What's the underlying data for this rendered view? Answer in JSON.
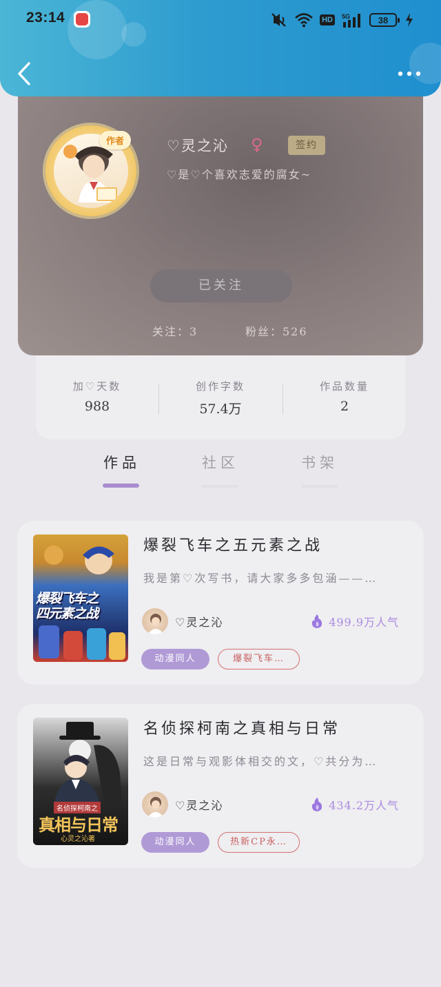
{
  "status_bar": {
    "time": "23:14",
    "signal": "5G",
    "hd": "HD",
    "battery": "38"
  },
  "header": {
    "back_icon": "chevron-left-icon",
    "more_icon": "more-horizontal-icon"
  },
  "profile": {
    "author_tag": "作者",
    "name": "♡灵之沁",
    "gender_symbol": "♀",
    "sign_badge": "签约",
    "bio": "♡是♡个喜欢志爱的腐女~",
    "follow_button": "已关注",
    "following": "关注：3",
    "fans": "粉丝：526"
  },
  "stats": [
    {
      "label": "加♡天数",
      "value": "988"
    },
    {
      "label": "创作字数",
      "value": "57.4万"
    },
    {
      "label": "作品数量",
      "value": "2"
    }
  ],
  "tabs": [
    {
      "label": "作品",
      "active": true
    },
    {
      "label": "社区",
      "active": false
    },
    {
      "label": "书架",
      "active": false
    }
  ],
  "books": [
    {
      "title": "爆裂飞车之五元素之战",
      "description": "我是第♡次写书，请大家多多包涵——…",
      "cover_text_1": "爆裂飞车之",
      "cover_text_2": "四元素之战",
      "author": "♡灵之沁",
      "popularity": "499.9万人气",
      "category": "动漫同人",
      "keyword": "爆裂飞车…"
    },
    {
      "title": "名侦探柯南之真相与日常",
      "description": "这是日常与观影体相交的文，♡共分为…",
      "cover_text_1": "名侦探柯南之",
      "cover_text_2": "真相与日常",
      "cover_text_3": "心灵之沁著",
      "author": "♡灵之沁",
      "popularity": "434.2万人气",
      "category": "动漫同人",
      "keyword": "热新CP永…"
    }
  ],
  "colors": {
    "header_blue": "#2e9ccf",
    "accent_purple": "#a88ccf",
    "popularity_purple": "#a98be0",
    "keyword_red": "#c86060"
  }
}
